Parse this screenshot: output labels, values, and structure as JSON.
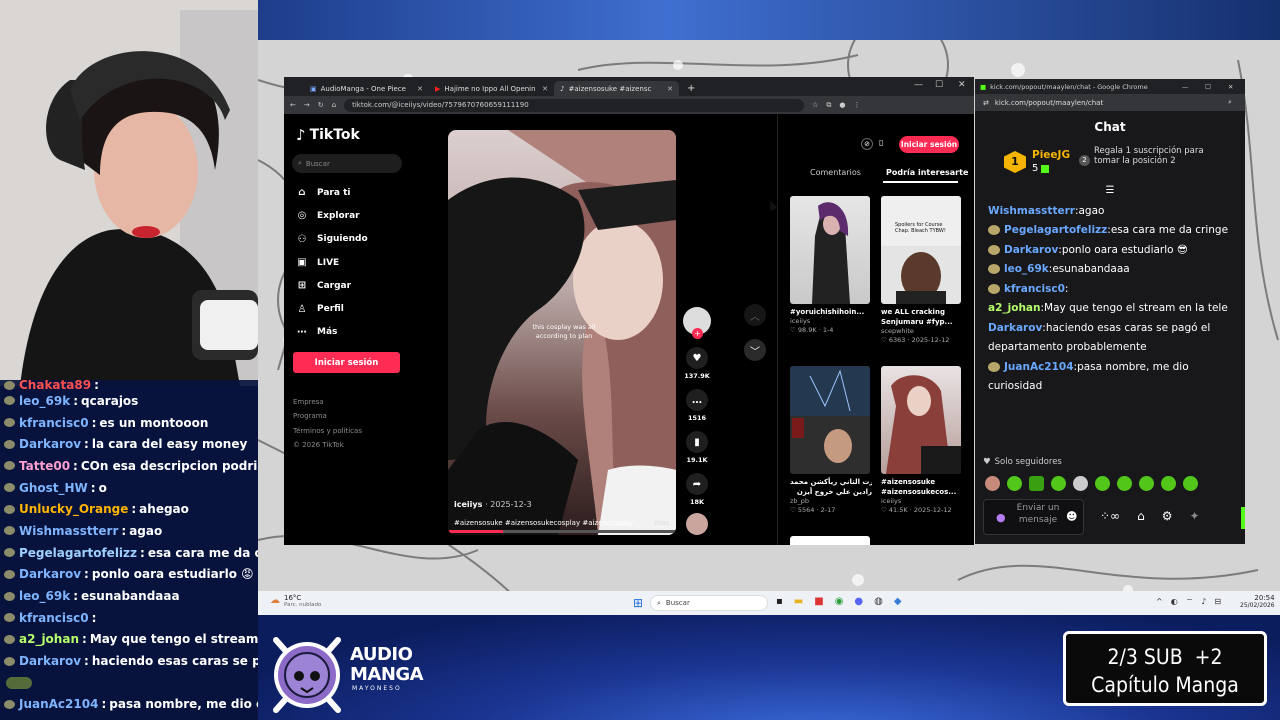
{
  "stream_overlay": {
    "chat_rows": [
      {
        "user": "Chakata89",
        "message": "",
        "color": "#ff5050"
      },
      {
        "user": "leo_69k",
        "message": "qcarajos",
        "color": "#7fb4ff"
      },
      {
        "user": "kfrancisc0",
        "message": "es un montooon",
        "color": "#7fb4ff"
      },
      {
        "user": "Darkarov",
        "message": "la cara del easy money",
        "color": "#7fb4ff"
      },
      {
        "user": "Tatte00",
        "message": "COn esa descripcion podria ser cua",
        "color": "#ff9fd0"
      },
      {
        "user": "Ghost_HW",
        "message": "o",
        "color": "#7fb4ff"
      },
      {
        "user": "Unlucky_Orange",
        "message": "ahegao",
        "color": "#ffb400"
      },
      {
        "user": "Wishmasstterr",
        "message": "agao",
        "color": "#7fb4ff"
      },
      {
        "user": "Pegelagartofelizz",
        "message": "esa cara me da cringe",
        "color": "#9fd0ff"
      },
      {
        "user": "Darkarov",
        "message": "ponlo oara estudiarlo 😡",
        "color": "#7fb4ff"
      },
      {
        "user": "leo_69k",
        "message": "esunabandaaa",
        "color": "#7fb4ff"
      },
      {
        "user": "kfrancisc0",
        "message": "",
        "color": "#7fb4ff"
      },
      {
        "user": "a2_johan",
        "message": "May que tengo el stream en la tele",
        "color": "#b6ff6a"
      },
      {
        "user": "Darkarov",
        "message": "haciendo esas caras se pagó el depa",
        "color": "#7fb4ff"
      },
      {
        "user": "",
        "message": "",
        "color": "#7fb4ff"
      },
      {
        "user": "JuanAc2104",
        "message": "pasa nombre, me dio curiosida",
        "color": "#7fb4ff"
      }
    ],
    "logo_text_1": "AUDIO",
    "logo_text_2": "MANGA",
    "logo_text_3": "MAYONESO",
    "sub_goal": "2/3 SUB  +2",
    "sub_goal_2": "Capítulo Manga"
  },
  "browser": {
    "tabs": [
      {
        "label": "AudioManga - One Piece",
        "active": false
      },
      {
        "label": "Hajime no Ippo All Openin",
        "active": false
      },
      {
        "label": "#aizensosuke #aizensc",
        "active": true
      }
    ],
    "new_tab": "+",
    "url": "tiktok.com/@iceiiys/video/7579670760659111190"
  },
  "tiktok": {
    "logo": "TikTok",
    "search_placeholder": "Buscar",
    "nav": [
      {
        "label": "Para ti",
        "icon": "home-icon"
      },
      {
        "label": "Explorar",
        "icon": "compass-icon"
      },
      {
        "label": "Siguiendo",
        "icon": "following-icon"
      },
      {
        "label": "LIVE",
        "icon": "live-icon"
      },
      {
        "label": "Cargar",
        "icon": "upload-icon"
      },
      {
        "label": "Perfil",
        "icon": "profile-icon"
      },
      {
        "label": "Más",
        "icon": "more-icon"
      }
    ],
    "login_button": "Iniciar sesión",
    "footer": [
      "Empresa",
      "Programa",
      "Términos y políticas",
      "© 2026 TikTok"
    ],
    "video": {
      "overlay_text": "this cosplay was all according to plan",
      "author": "iceiiys",
      "date": "· 2025-12-3",
      "hashtags": "#aizensosuke #aizensosukecosplay #aizencosplay ...",
      "more": "más"
    },
    "actions": [
      {
        "name": "like",
        "count": "137.9K"
      },
      {
        "name": "comment",
        "count": "1516"
      },
      {
        "name": "save",
        "count": "19.1K"
      },
      {
        "name": "share",
        "count": "18K"
      }
    ],
    "right_login": "Iniciar sesión",
    "right_tabs": [
      "Comentarios",
      "Podría interesarte"
    ],
    "suggestions": [
      {
        "caption": "#yoruichishihoin...",
        "author": "iceiiys",
        "stats": "♡ 98.9K · 1-4",
        "color": "#d8d8d8"
      },
      {
        "caption": "we ALL cracking Senjumaru #fyp...",
        "author": "scepwhite",
        "stats": "♡ 6363 · 2025-12-12",
        "color": "#cfcfcf"
      },
      {
        "caption": "بارت التاني ريأكشن محمد",
        "caption2": "رادين علي خروج أيزن",
        "author": "zb_pb",
        "stats": "♡ 5564 · 2-17",
        "color": "#1f2a38"
      },
      {
        "caption": "#aizensosuke #aizensosukecos...",
        "author": "iceiiys",
        "stats": "♡ 41.5K · 2025-12-12",
        "color": "#c5b5b2"
      }
    ],
    "thumb_title": "Spoilers for Course Chap. Bleach TYBW!"
  },
  "kick": {
    "window_title": "kick.com/popout/maaylen/chat - Google Chrome",
    "url": "kick.com/popout/maaylen/chat",
    "header": "Chat",
    "top_gifter": {
      "name": "PieeJG",
      "rank": "1",
      "count": "5"
    },
    "gift_prompt_number": "2",
    "gift_prompt": "Regala 1 suscripción para tomar la posición 2",
    "messages": [
      {
        "user": "Wishmasstterr",
        "message": "agao",
        "color": "#6aa8ff"
      },
      {
        "user": "Pegelagartofelizz",
        "message": "esa cara me da cringe",
        "color": "#6aa8ff"
      },
      {
        "user": "Darkarov",
        "message": "ponlo oara estudiarlo 😎",
        "color": "#6aa8ff"
      },
      {
        "user": "leo_69k",
        "message": "esunabandaaa",
        "color": "#6aa8ff"
      },
      {
        "user": "kfrancisc0",
        "message": "",
        "color": "#6aa8ff"
      },
      {
        "user": "a2_johan",
        "message": "May que tengo el stream en la tele",
        "color": "#b6ff6a"
      },
      {
        "user": "Darkarov",
        "message": "haciendo esas caras se pagó el",
        "color": "#6aa8ff"
      },
      {
        "user": "",
        "message": "departamento probablemente",
        "color": "#6aa8ff"
      },
      {
        "user": "JuanAc2104",
        "message": "pasa nombre, me dio",
        "color": "#6aa8ff"
      },
      {
        "user": "",
        "message": "curiosidad",
        "color": "#6aa8ff"
      }
    ],
    "followers_only": "Solo seguidores",
    "input_placeholder": "Enviar un mensaje"
  },
  "taskbar": {
    "weather_temp": "16°C",
    "weather_desc": "Parc. nublado",
    "search": "Buscar",
    "time": "20:54",
    "date": "25/02/2026"
  },
  "colors": {
    "tiktok_red": "#fe2c55",
    "kick_green": "#53fc18",
    "gift_gold": "#f5b400"
  }
}
